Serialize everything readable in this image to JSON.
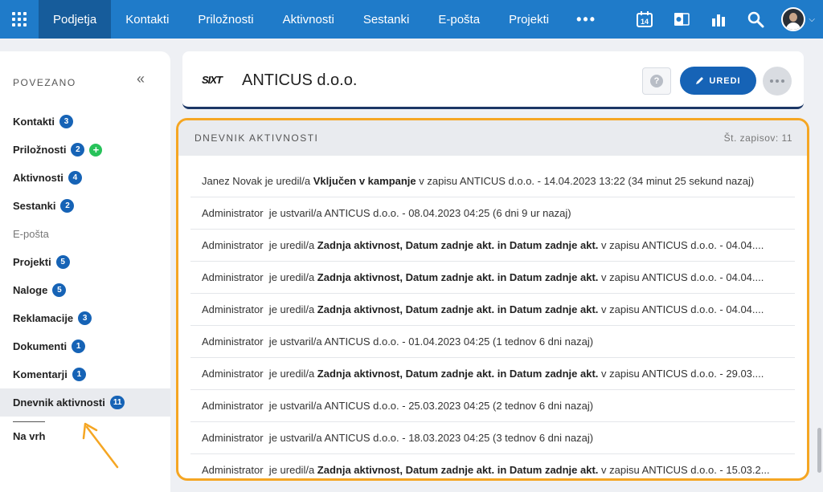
{
  "nav": {
    "items": [
      "Podjetja",
      "Kontakti",
      "Priložnosti",
      "Aktivnosti",
      "Sestanki",
      "E-pošta",
      "Projekti"
    ],
    "more": "•••",
    "calendar_day": "14"
  },
  "sidebar": {
    "heading": "POVEZANO",
    "collapse": "«",
    "items": [
      {
        "label": "Kontakti",
        "count": "3"
      },
      {
        "label": "Priložnosti",
        "count": "2"
      },
      {
        "label": "Aktivnosti",
        "count": "4"
      },
      {
        "label": "Sestanki",
        "count": "2"
      },
      {
        "label": "E-pošta",
        "count": ""
      },
      {
        "label": "Projekti",
        "count": "5"
      },
      {
        "label": "Naloge",
        "count": "5"
      },
      {
        "label": "Reklamacije",
        "count": "3"
      },
      {
        "label": "Dokumenti",
        "count": "1"
      },
      {
        "label": "Komentarji",
        "count": "1"
      },
      {
        "label": "Dnevnik aktivnosti",
        "count": "11"
      }
    ],
    "top_link": "Na vrh"
  },
  "header": {
    "logo_text": "SIXT",
    "company_name": "ANTICUS d.o.o.",
    "help": "?",
    "edit_label": "UREDI"
  },
  "log": {
    "title": "DNEVNIK AKTIVNOSTI",
    "count_label": "Št. zapisov: 11",
    "rows": [
      {
        "pre": "Janez Novak je uredil/a ",
        "bold": "Vključen v kampanje",
        "post": " v zapisu ANTICUS d.o.o. - 14.04.2023 13:22 (34 minut 25 sekund nazaj)"
      },
      {
        "pre": "Administrator  je ustvaril/a ANTICUS d.o.o. - 08.04.2023 04:25 (6 dni 9 ur nazaj)",
        "bold": "",
        "post": ""
      },
      {
        "pre": "Administrator  je uredil/a ",
        "bold": "Zadnja aktivnost, Datum zadnje akt. in Datum zadnje akt.",
        "post": " v zapisu ANTICUS d.o.o. - 04.04...."
      },
      {
        "pre": "Administrator  je uredil/a ",
        "bold": "Zadnja aktivnost, Datum zadnje akt. in Datum zadnje akt.",
        "post": " v zapisu ANTICUS d.o.o. - 04.04...."
      },
      {
        "pre": "Administrator  je uredil/a ",
        "bold": "Zadnja aktivnost, Datum zadnje akt. in Datum zadnje akt.",
        "post": " v zapisu ANTICUS d.o.o. - 04.04...."
      },
      {
        "pre": "Administrator  je ustvaril/a ANTICUS d.o.o. - 01.04.2023 04:25 (1 tednov 6 dni nazaj)",
        "bold": "",
        "post": ""
      },
      {
        "pre": "Administrator  je uredil/a ",
        "bold": "Zadnja aktivnost, Datum zadnje akt. in Datum zadnje akt.",
        "post": " v zapisu ANTICUS d.o.o. - 29.03...."
      },
      {
        "pre": "Administrator  je ustvaril/a ANTICUS d.o.o. - 25.03.2023 04:25 (2 tednov 6 dni nazaj)",
        "bold": "",
        "post": ""
      },
      {
        "pre": "Administrator  je ustvaril/a ANTICUS d.o.o. - 18.03.2023 04:25 (3 tednov 6 dni nazaj)",
        "bold": "",
        "post": ""
      },
      {
        "pre": "Administrator  je uredil/a ",
        "bold": "Zadnja aktivnost, Datum zadnje akt. in Datum zadnje akt.",
        "post": " v zapisu ANTICUS d.o.o. - 15.03.2..."
      }
    ]
  },
  "colors": {
    "nav_bg": "#1f7bc9",
    "nav_active": "#165c9b",
    "badge": "#1663b6",
    "highlight": "#f5a623",
    "plus": "#27c25a"
  }
}
